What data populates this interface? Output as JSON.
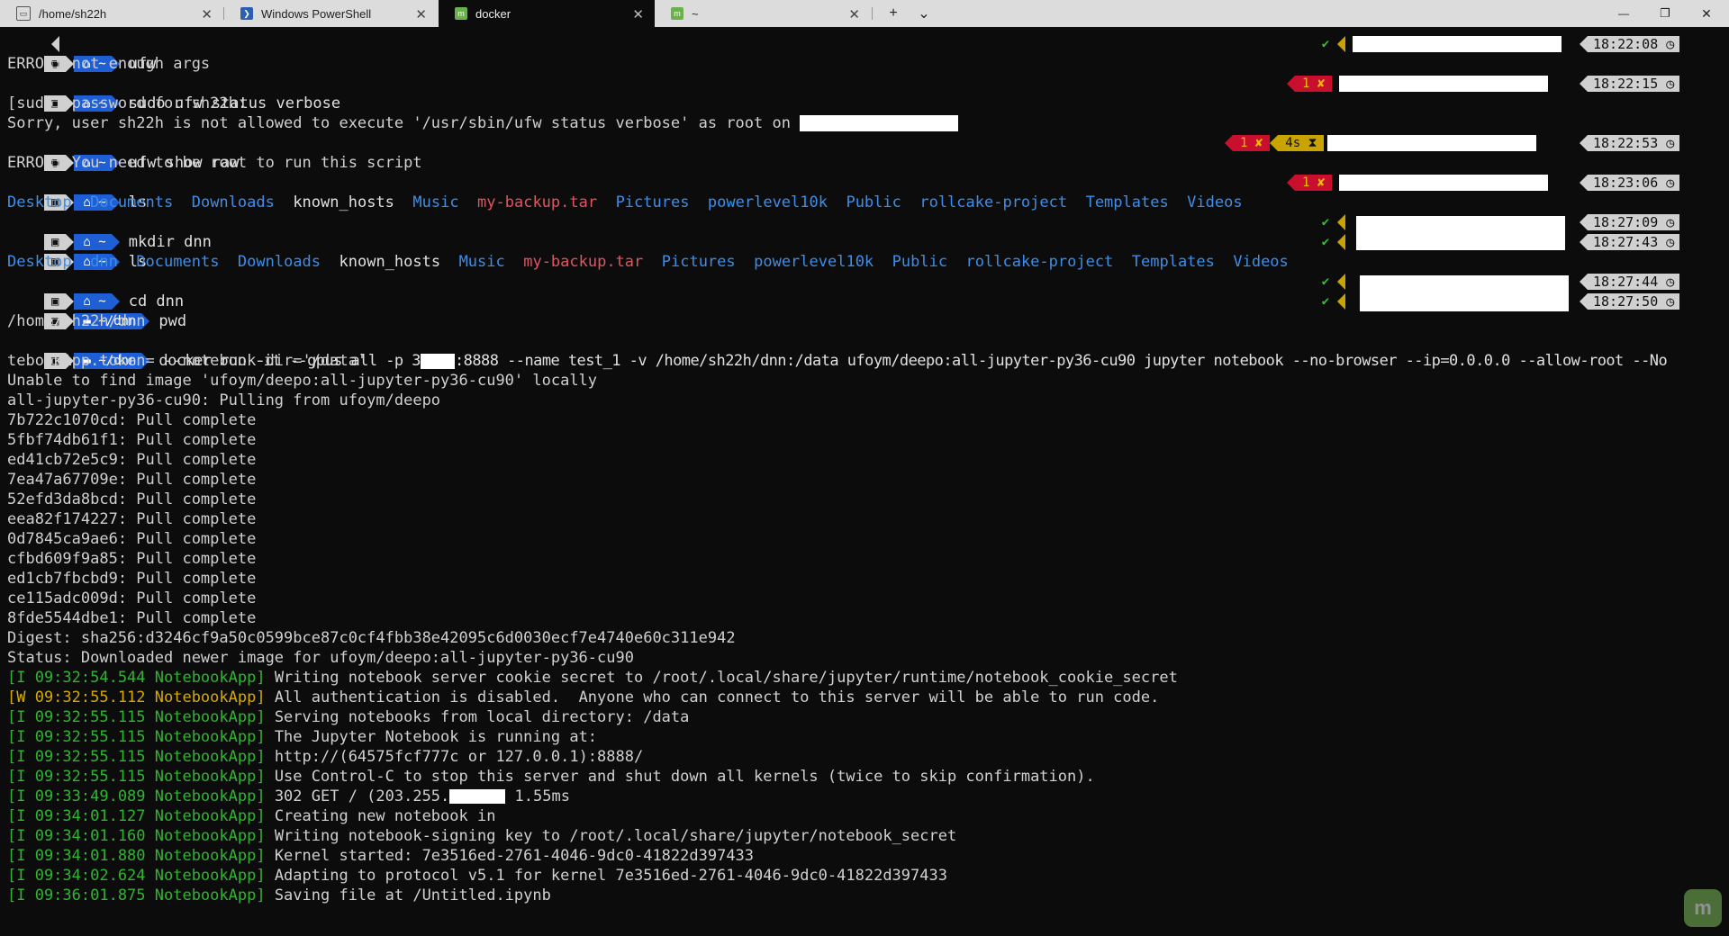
{
  "tabs": [
    {
      "title": "/home/sh22h",
      "icon": "terminal-icon"
    },
    {
      "title": "Windows PowerShell",
      "icon": "powershell-icon"
    },
    {
      "title": "docker",
      "icon": "mint-icon"
    },
    {
      "title": "~",
      "icon": "mint-icon"
    }
  ],
  "window": {
    "new_tab": "+",
    "dropdown": "⌄",
    "minimize": "—",
    "restore": "❐",
    "close": "✕"
  },
  "prompt": {
    "os_glyph": "▣",
    "home_glyph": "⌂",
    "home_dir": "~",
    "dnn_dir": "~/dnn",
    "folder_glyph": "▬"
  },
  "lines": {
    "c1": "ufw",
    "o1": "ERROR: not enough args",
    "c2": "sudo ufw status verbose",
    "o2": "[sudo] password for sh22h:",
    "o3": "Sorry, user sh22h is not allowed to execute '/usr/sbin/ufw status verbose' as root on ",
    "c3": "ufw show raw",
    "o4": "ERROR: You need to be root to run this script",
    "c4": "ls",
    "c5": "mkdir dnn",
    "c6": "ls",
    "c7": "cd dnn",
    "c8": "pwd",
    "o5": "/home/sh22h/dnn",
    "c9a": "docker run -it --gpus all -p 3",
    "c9b": ":8888 --name test_1 -v /home/sh22h/dnn:/data ufoym/deepo:all-jupyter-py36-cu90 jupyter notebook --no-browser --ip=0.0.0.0 --allow-root --No",
    "c9c": "tebookApp.token= --notebook-dir='/data'",
    "o6": "Unable to find image 'ufoym/deepo:all-jupyter-py36-cu90' locally",
    "o7": "all-jupyter-py36-cu90: Pulling from ufoym/deepo",
    "digest": "Digest: sha256:d3246cf9a50c0599bce87c0cf4fbb38e42095c6d0030ecf7e4740e60c311e942",
    "status": "Status: Downloaded newer image for ufoym/deepo:all-jupyter-py36-cu90"
  },
  "ls1": [
    {
      "t": "Desktop",
      "c": "blue"
    },
    {
      "t": "Documents",
      "c": "blue"
    },
    {
      "t": "Downloads",
      "c": "blue"
    },
    {
      "t": "known_hosts",
      "c": "white"
    },
    {
      "t": "Music",
      "c": "blue"
    },
    {
      "t": "my-backup.tar",
      "c": "red"
    },
    {
      "t": "Pictures",
      "c": "blue"
    },
    {
      "t": "powerlevel10k",
      "c": "blue"
    },
    {
      "t": "Public",
      "c": "blue"
    },
    {
      "t": "rollcake-project",
      "c": "blue"
    },
    {
      "t": "Templates",
      "c": "blue"
    },
    {
      "t": "Videos",
      "c": "blue"
    }
  ],
  "ls2": [
    {
      "t": "Desktop",
      "c": "blue"
    },
    {
      "t": "dnn",
      "c": "blue"
    },
    {
      "t": "Documents",
      "c": "blue"
    },
    {
      "t": "Downloads",
      "c": "blue"
    },
    {
      "t": "known_hosts",
      "c": "white"
    },
    {
      "t": "Music",
      "c": "blue"
    },
    {
      "t": "my-backup.tar",
      "c": "red"
    },
    {
      "t": "Pictures",
      "c": "blue"
    },
    {
      "t": "powerlevel10k",
      "c": "blue"
    },
    {
      "t": "Public",
      "c": "blue"
    },
    {
      "t": "rollcake-project",
      "c": "blue"
    },
    {
      "t": "Templates",
      "c": "blue"
    },
    {
      "t": "Videos",
      "c": "blue"
    }
  ],
  "pulls": [
    "7b722c1070cd: Pull complete",
    "5fbf74db61f1: Pull complete",
    "ed41cb72e5c9: Pull complete",
    "7ea47a67709e: Pull complete",
    "52efd3da8bcd: Pull complete",
    "eea82f174227: Pull complete",
    "0d7845ca9ae6: Pull complete",
    "cfbd609f9a85: Pull complete",
    "ed1cb7fbcbd9: Pull complete",
    "ce115adc009d: Pull complete",
    "8fde5544dbe1: Pull complete"
  ],
  "logs": [
    {
      "p": "[I 09:32:54.544 NotebookApp]",
      "m": "Writing notebook server cookie secret to /root/.local/share/jupyter/runtime/notebook_cookie_secret",
      "lvl": "I"
    },
    {
      "p": "[W 09:32:55.112 NotebookApp]",
      "m": "All authentication is disabled.  Anyone who can connect to this server will be able to run code.",
      "lvl": "W"
    },
    {
      "p": "[I 09:32:55.115 NotebookApp]",
      "m": "Serving notebooks from local directory: /data",
      "lvl": "I"
    },
    {
      "p": "[I 09:32:55.115 NotebookApp]",
      "m": "The Jupyter Notebook is running at:",
      "lvl": "I"
    },
    {
      "p": "[I 09:32:55.115 NotebookApp]",
      "m": "http://(64575fcf777c or 127.0.0.1):8888/",
      "lvl": "I"
    },
    {
      "p": "[I 09:32:55.115 NotebookApp]",
      "m": "Use Control-C to stop this server and shut down all kernels (twice to skip confirmation).",
      "lvl": "I"
    },
    {
      "p": "[I 09:33:49.089 NotebookApp]",
      "m": "302 GET / (203.255.",
      "m2": " 1.55ms",
      "lvl": "I"
    },
    {
      "p": "[I 09:34:01.127 NotebookApp]",
      "m": "Creating new notebook in",
      "lvl": "I"
    },
    {
      "p": "[I 09:34:01.160 NotebookApp]",
      "m": "Writing notebook-signing key to /root/.local/share/jupyter/notebook_secret",
      "lvl": "I"
    },
    {
      "p": "[I 09:34:01.880 NotebookApp]",
      "m": "Kernel started: 7e3516ed-2761-4046-9dc0-41822d397433",
      "lvl": "I"
    },
    {
      "p": "[I 09:34:02.624 NotebookApp]",
      "m": "Adapting to protocol v5.1 for kernel 7e3516ed-2761-4046-9dc0-41822d397433",
      "lvl": "I"
    },
    {
      "p": "[I 09:36:01.875 NotebookApp]",
      "m": "Saving file at /Untitled.ipynb",
      "lvl": "I"
    }
  ],
  "right_prompts": {
    "t1": "18:22:08",
    "t2": "18:22:15",
    "t3": "18:22:53",
    "t4": "18:23:06",
    "t5": "18:27:09",
    "t6": "18:27:43",
    "t7": "18:27:44",
    "t8": "18:27:50",
    "err": "1 ✘",
    "dur": "4s ⧗",
    "ok": "✔",
    "clock": "◷"
  },
  "colors": {
    "log_info": "#2fb52f",
    "log_warn": "#d7a800",
    "dir_blue": "#3b8eea",
    "archive_red": "#e05561",
    "err_bg": "#c8102e",
    "dur_bg": "#c9a300"
  }
}
